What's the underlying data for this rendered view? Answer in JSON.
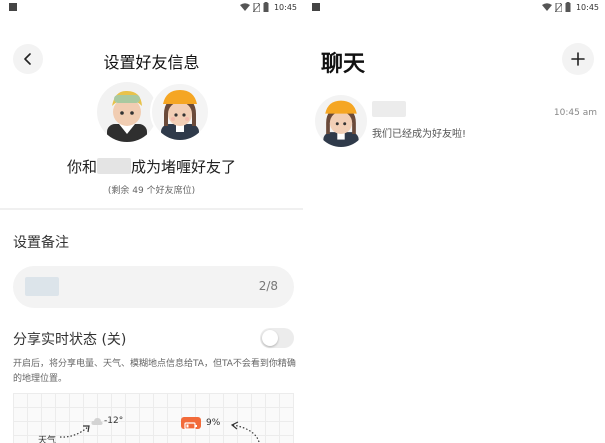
{
  "left": {
    "statusbar": {
      "time": "10:45"
    },
    "header": {
      "title": "设置好友信息"
    },
    "friends_line": {
      "prefix": "你和",
      "suffix": "成为堵喱好友了"
    },
    "remaining": "(剩余 49 个好友席位)",
    "remark": {
      "section_title": "设置备注",
      "count": "2/8"
    },
    "share": {
      "label": "分享实时状态 (关)",
      "description": "开启后，将分享电量、天气、模糊地点信息给TA，但TA不会看到你精确的地理位置。",
      "toggle_state": "off"
    },
    "preview": {
      "weather_label": "天气",
      "temperature": "-12°",
      "battery": "9%"
    }
  },
  "right": {
    "statusbar": {
      "time": "10:45"
    },
    "title": "聊天",
    "chat_list": [
      {
        "time": "10:45 am",
        "preview": "我们已经成为好友啦!"
      }
    ]
  },
  "colors": {
    "accent": "#f26b3a",
    "hat": "#f5a623",
    "toggle_off": "#ececec"
  }
}
